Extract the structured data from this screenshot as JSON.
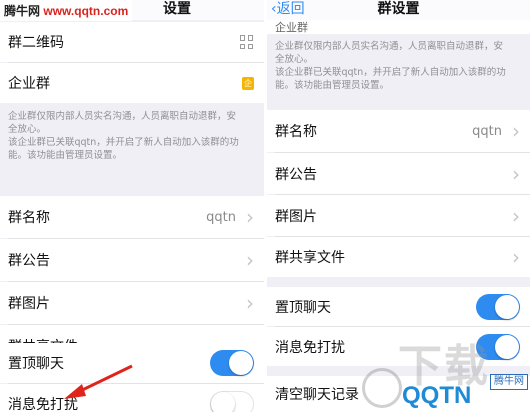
{
  "watermark_top": {
    "part1": "腾牛网",
    "part2": "www.qqtn.com"
  },
  "left": {
    "nav_title_partial": "设置",
    "rows": {
      "qr": "群二维码",
      "enterprise": "企业群",
      "name_label": "群名称",
      "name_value": "qqtn",
      "notice": "群公告",
      "images": "群图片",
      "files": "群共享文件",
      "pin": "置顶聊天",
      "mute": "消息免打扰"
    },
    "note_lines": [
      "企业群仅限内部人员实名沟通，人员离职自动退群，安",
      "全放心。",
      "该企业群已关联qqtn，并开启了新人自动加入该群的功",
      "能。该功能由管理员设置。"
    ],
    "pin_on": true,
    "mute_on": false
  },
  "right": {
    "back_label": "返回",
    "nav_title": "群设置",
    "enterprise_partial": "企业群",
    "note_lines": [
      "企业群仅限内部人员实名沟通，人员离职自动退群，安",
      "全放心。",
      "该企业群已关联qqtn，并开启了新人自动加入该群的功",
      "能。该功能由管理员设置。"
    ],
    "rows": {
      "name_label": "群名称",
      "name_value": "qqtn",
      "notice": "群公告",
      "images": "群图片",
      "files": "群共享文件",
      "pin": "置顶聊天",
      "mute": "消息免打扰",
      "clear": "清空聊天记录"
    },
    "pin_on": true,
    "mute_on": true
  },
  "watermark_bottom": {
    "big": "下载",
    "brand": "QQTN",
    "tag": "腾牛网"
  },
  "colors": {
    "accent": "#2e8cf0",
    "badge": "#f4b400",
    "background": "#f0eff5"
  },
  "icons": {
    "qr": "qr-code-icon",
    "enterprise": "enterprise-badge-icon",
    "chevron": "chevron-right-icon",
    "back": "chevron-left-icon"
  }
}
